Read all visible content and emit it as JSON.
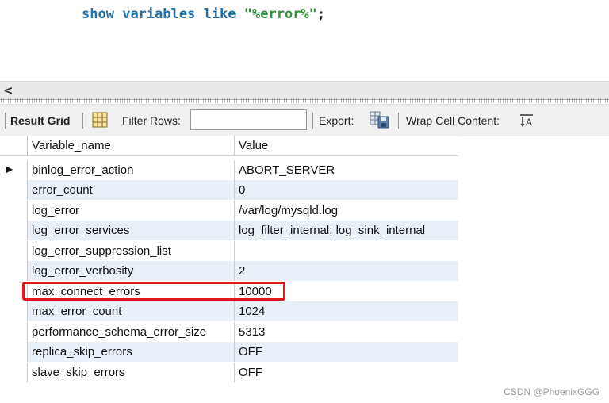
{
  "editor": {
    "kw1": "show",
    "kw2": "variables",
    "kw3": "like",
    "str": "\"%error%\"",
    "semi": ";"
  },
  "scrollbar": {
    "left_arrow": "<"
  },
  "toolbar": {
    "result_grid": "Result Grid",
    "filter_rows": "Filter Rows:",
    "filter_value": "",
    "export": "Export:",
    "wrap_cell": "Wrap Cell Content:"
  },
  "grid": {
    "columns": [
      "Variable_name",
      "Value"
    ],
    "rows": [
      [
        "binlog_error_action",
        "ABORT_SERVER"
      ],
      [
        "error_count",
        "0"
      ],
      [
        "log_error",
        "/var/log/mysqld.log"
      ],
      [
        "log_error_services",
        "log_filter_internal; log_sink_internal"
      ],
      [
        "log_error_suppression_list",
        ""
      ],
      [
        "log_error_verbosity",
        "2"
      ],
      [
        "max_connect_errors",
        "10000"
      ],
      [
        "max_error_count",
        "1024"
      ],
      [
        "performance_schema_error_size",
        "5313"
      ],
      [
        "replica_skip_errors",
        "OFF"
      ],
      [
        "slave_skip_errors",
        "OFF"
      ]
    ],
    "current_row_marker": "▶"
  },
  "watermark": "CSDN @PhoenixGGG",
  "colors": {
    "highlight": "#e3161c",
    "alt_row": "#e9f0f8",
    "keyword": "#1e6ea8",
    "string": "#2f8f3a"
  }
}
